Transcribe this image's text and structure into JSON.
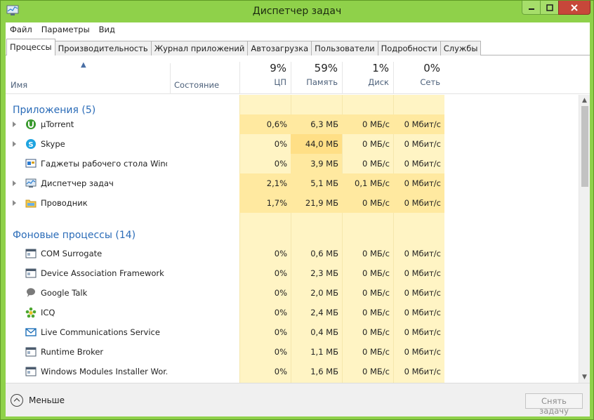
{
  "window": {
    "title": "Диспетчер задач"
  },
  "menu": [
    "Файл",
    "Параметры",
    "Вид"
  ],
  "tabs": [
    "Процессы",
    "Производительность",
    "Журнал приложений",
    "Автозагрузка",
    "Пользователи",
    "Подробности",
    "Службы"
  ],
  "active_tab": "Процессы",
  "columns": {
    "name": "Имя",
    "state": "Состояние",
    "cpu": {
      "label": "ЦП",
      "pct": "9%"
    },
    "mem": {
      "label": "Память",
      "pct": "59%"
    },
    "disk": {
      "label": "Диск",
      "pct": "1%"
    },
    "net": {
      "label": "Сеть",
      "pct": "0%"
    }
  },
  "groups": {
    "apps": "Приложения (5)",
    "background": "Фоновые процессы (14)"
  },
  "rows": [
    {
      "name": "µTorrent",
      "cpu": "0,6%",
      "mem": "6,3 МБ",
      "disk": "0 МБ/с",
      "net": "0 Мбит/с",
      "icon": "utorrent-icon",
      "expand": true
    },
    {
      "name": "Skype",
      "cpu": "0%",
      "mem": "44,0 МБ",
      "disk": "0 МБ/с",
      "net": "0 Мбит/с",
      "icon": "skype-icon",
      "expand": true
    },
    {
      "name": "Гаджеты рабочего стола Wind...",
      "cpu": "0%",
      "mem": "3,9 МБ",
      "disk": "0 МБ/с",
      "net": "0 Мбит/с",
      "icon": "gadgets-icon",
      "expand": false
    },
    {
      "name": "Диспетчер задач",
      "cpu": "2,1%",
      "mem": "5,1 МБ",
      "disk": "0,1 МБ/с",
      "net": "0 Мбит/с",
      "icon": "task-manager-icon",
      "expand": true
    },
    {
      "name": "Проводник",
      "cpu": "1,7%",
      "mem": "21,9 МБ",
      "disk": "0 МБ/с",
      "net": "0 Мбит/с",
      "icon": "explorer-folder-icon",
      "expand": true
    },
    {
      "name": "COM Surrogate",
      "cpu": "0%",
      "mem": "0,6 МБ",
      "disk": "0 МБ/с",
      "net": "0 Мбит/с",
      "icon": "window-app-icon",
      "expand": false
    },
    {
      "name": "Device Association Framework ...",
      "cpu": "0%",
      "mem": "2,3 МБ",
      "disk": "0 МБ/с",
      "net": "0 Мбит/с",
      "icon": "window-app-icon",
      "expand": false
    },
    {
      "name": "Google Talk",
      "cpu": "0%",
      "mem": "2,0 МБ",
      "disk": "0 МБ/с",
      "net": "0 Мбит/с",
      "icon": "google-talk-icon",
      "expand": false
    },
    {
      "name": "ICQ",
      "cpu": "0%",
      "mem": "2,4 МБ",
      "disk": "0 МБ/с",
      "net": "0 Мбит/с",
      "icon": "icq-flower-icon",
      "expand": false
    },
    {
      "name": "Live Communications Service",
      "cpu": "0%",
      "mem": "0,4 МБ",
      "disk": "0 МБ/с",
      "net": "0 Мбит/с",
      "icon": "mail-envelope-icon",
      "expand": false
    },
    {
      "name": "Runtime Broker",
      "cpu": "0%",
      "mem": "1,1 МБ",
      "disk": "0 МБ/с",
      "net": "0 Мбит/с",
      "icon": "window-app-icon",
      "expand": false
    },
    {
      "name": "Windows Modules Installer Wor...",
      "cpu": "0%",
      "mem": "1,6 МБ",
      "disk": "0 МБ/с",
      "net": "0 Мбит/с",
      "icon": "window-app-icon",
      "expand": false
    }
  ],
  "footer": {
    "less_label": "Меньше",
    "end_task_label": "Снять задачу"
  },
  "colors": {
    "frame": "#8fd14a",
    "heat_light": "#fff4c4",
    "heat_mid": "#ffe9a0",
    "heat_strong": "#ffdf86",
    "group_title": "#2b6cb8"
  }
}
